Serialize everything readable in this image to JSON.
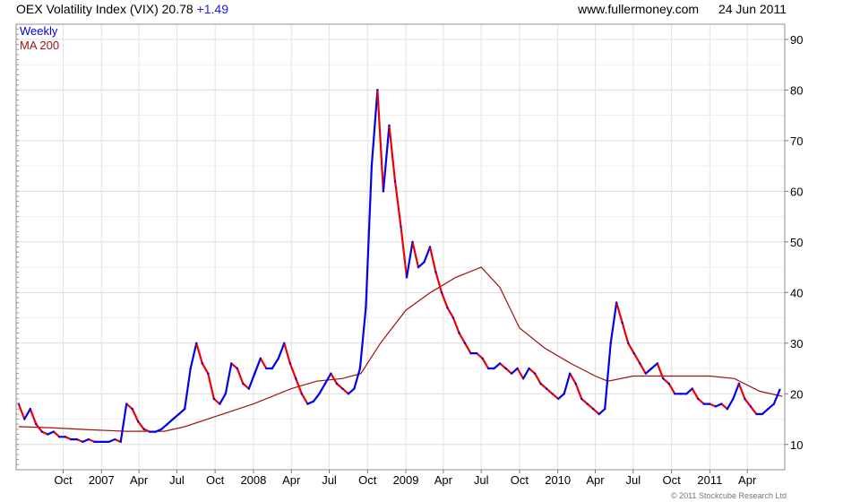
{
  "header": {
    "title": "OEX Volatility Index (VIX)",
    "last": "20.78",
    "change": "+1.49",
    "site": "www.fullermoney.com",
    "date": "24 Jun 2011"
  },
  "footer": {
    "copyright": "© 2011 Stockcube Research Ltd"
  },
  "colors": {
    "up": "#0000ee",
    "down": "#ee0000",
    "ma": "#a01010",
    "grid": "#e3e3e3",
    "frame": "#909090"
  },
  "chart_data": {
    "type": "line",
    "title": "OEX Volatility Index (VIX)",
    "frequency": "Weekly",
    "y_axis_side": "right",
    "ylim": [
      5,
      93
    ],
    "xlim": [
      "2006-06-10",
      "2011-06-30"
    ],
    "grid": true,
    "legend": [
      "Weekly",
      "MA 200"
    ],
    "legend_position": "top-left",
    "y_ticks": [
      10,
      20,
      30,
      40,
      50,
      60,
      70,
      80,
      90
    ],
    "x_ticks": [
      {
        "label": "Oct",
        "date": "2006-10-01"
      },
      {
        "label": "2007",
        "date": "2007-01-01"
      },
      {
        "label": "Apr",
        "date": "2007-04-01"
      },
      {
        "label": "Jul",
        "date": "2007-07-01"
      },
      {
        "label": "Oct",
        "date": "2007-10-01"
      },
      {
        "label": "2008",
        "date": "2008-01-01"
      },
      {
        "label": "Apr",
        "date": "2008-04-01"
      },
      {
        "label": "Jul",
        "date": "2008-07-01"
      },
      {
        "label": "Oct",
        "date": "2008-10-01"
      },
      {
        "label": "2009",
        "date": "2009-01-01"
      },
      {
        "label": "Apr",
        "date": "2009-04-01"
      },
      {
        "label": "Jul",
        "date": "2009-07-01"
      },
      {
        "label": "Oct",
        "date": "2009-10-01"
      },
      {
        "label": "2010",
        "date": "2010-01-01"
      },
      {
        "label": "Apr",
        "date": "2010-04-01"
      },
      {
        "label": "Jul",
        "date": "2010-07-01"
      },
      {
        "label": "Oct",
        "date": "2010-10-01"
      },
      {
        "label": "2011",
        "date": "2011-01-01"
      },
      {
        "label": "Apr",
        "date": "2011-04-01"
      }
    ],
    "series": [
      {
        "name": "Weekly",
        "points": [
          [
            "2006-06-16",
            18
          ],
          [
            "2006-06-30",
            15
          ],
          [
            "2006-07-14",
            17
          ],
          [
            "2006-07-28",
            14
          ],
          [
            "2006-08-11",
            12.5
          ],
          [
            "2006-08-25",
            12
          ],
          [
            "2006-09-08",
            12.5
          ],
          [
            "2006-09-22",
            11.5
          ],
          [
            "2006-10-06",
            11.5
          ],
          [
            "2006-10-20",
            11
          ],
          [
            "2006-11-03",
            11
          ],
          [
            "2006-11-17",
            10.5
          ],
          [
            "2006-12-01",
            11
          ],
          [
            "2006-12-15",
            10.5
          ],
          [
            "2007-01-05",
            10.5
          ],
          [
            "2007-01-19",
            10.5
          ],
          [
            "2007-02-02",
            11
          ],
          [
            "2007-02-16",
            10.5
          ],
          [
            "2007-03-02",
            18
          ],
          [
            "2007-03-16",
            17
          ],
          [
            "2007-03-30",
            14.5
          ],
          [
            "2007-04-13",
            13
          ],
          [
            "2007-04-27",
            12.5
          ],
          [
            "2007-05-11",
            12.5
          ],
          [
            "2007-05-25",
            13
          ],
          [
            "2007-06-08",
            14
          ],
          [
            "2007-06-22",
            15
          ],
          [
            "2007-07-06",
            16
          ],
          [
            "2007-07-20",
            17
          ],
          [
            "2007-08-03",
            25
          ],
          [
            "2007-08-17",
            30
          ],
          [
            "2007-08-31",
            26
          ],
          [
            "2007-09-14",
            24
          ],
          [
            "2007-09-28",
            19
          ],
          [
            "2007-10-12",
            18
          ],
          [
            "2007-10-26",
            20
          ],
          [
            "2007-11-09",
            26
          ],
          [
            "2007-11-23",
            25
          ],
          [
            "2007-12-07",
            22
          ],
          [
            "2007-12-21",
            21
          ],
          [
            "2008-01-04",
            24
          ],
          [
            "2008-01-18",
            27
          ],
          [
            "2008-02-01",
            25
          ],
          [
            "2008-02-15",
            25
          ],
          [
            "2008-03-01",
            27
          ],
          [
            "2008-03-15",
            30
          ],
          [
            "2008-03-29",
            26
          ],
          [
            "2008-04-12",
            23
          ],
          [
            "2008-04-26",
            20
          ],
          [
            "2008-05-10",
            18
          ],
          [
            "2008-05-24",
            18.5
          ],
          [
            "2008-06-07",
            20
          ],
          [
            "2008-06-21",
            22
          ],
          [
            "2008-07-05",
            24
          ],
          [
            "2008-07-19",
            22
          ],
          [
            "2008-08-02",
            21
          ],
          [
            "2008-08-16",
            20
          ],
          [
            "2008-08-30",
            21
          ],
          [
            "2008-09-13",
            25
          ],
          [
            "2008-09-27",
            37
          ],
          [
            "2008-10-11",
            65
          ],
          [
            "2008-10-25",
            80
          ],
          [
            "2008-11-08",
            60
          ],
          [
            "2008-11-22",
            73
          ],
          [
            "2008-12-06",
            62
          ],
          [
            "2008-12-20",
            53
          ],
          [
            "2009-01-03",
            43
          ],
          [
            "2009-01-17",
            50
          ],
          [
            "2009-01-31",
            45
          ],
          [
            "2009-02-14",
            46
          ],
          [
            "2009-02-28",
            49
          ],
          [
            "2009-03-14",
            44
          ],
          [
            "2009-03-28",
            40
          ],
          [
            "2009-04-11",
            37
          ],
          [
            "2009-04-25",
            35
          ],
          [
            "2009-05-09",
            32
          ],
          [
            "2009-05-23",
            30
          ],
          [
            "2009-06-06",
            28
          ],
          [
            "2009-06-20",
            28
          ],
          [
            "2009-07-04",
            27
          ],
          [
            "2009-07-18",
            25
          ],
          [
            "2009-08-01",
            25
          ],
          [
            "2009-08-15",
            26
          ],
          [
            "2009-08-29",
            25
          ],
          [
            "2009-09-12",
            24
          ],
          [
            "2009-09-26",
            25
          ],
          [
            "2009-10-10",
            23
          ],
          [
            "2009-10-24",
            25
          ],
          [
            "2009-11-07",
            24
          ],
          [
            "2009-11-21",
            22
          ],
          [
            "2009-12-05",
            21
          ],
          [
            "2009-12-19",
            20
          ],
          [
            "2010-01-02",
            19
          ],
          [
            "2010-01-16",
            20
          ],
          [
            "2010-01-30",
            24
          ],
          [
            "2010-02-13",
            22
          ],
          [
            "2010-02-27",
            19
          ],
          [
            "2010-03-13",
            18
          ],
          [
            "2010-03-27",
            17
          ],
          [
            "2010-04-10",
            16
          ],
          [
            "2010-04-24",
            17
          ],
          [
            "2010-05-08",
            30
          ],
          [
            "2010-05-22",
            38
          ],
          [
            "2010-06-05",
            34
          ],
          [
            "2010-06-19",
            30
          ],
          [
            "2010-07-03",
            28
          ],
          [
            "2010-07-17",
            26
          ],
          [
            "2010-07-31",
            24
          ],
          [
            "2010-08-14",
            25
          ],
          [
            "2010-08-28",
            26
          ],
          [
            "2010-09-11",
            23
          ],
          [
            "2010-09-25",
            22
          ],
          [
            "2010-10-09",
            20
          ],
          [
            "2010-10-23",
            20
          ],
          [
            "2010-11-06",
            20
          ],
          [
            "2010-11-20",
            21
          ],
          [
            "2010-12-04",
            19
          ],
          [
            "2010-12-18",
            18
          ],
          [
            "2011-01-01",
            18
          ],
          [
            "2011-01-15",
            17.5
          ],
          [
            "2011-01-29",
            18
          ],
          [
            "2011-02-12",
            17
          ],
          [
            "2011-02-26",
            19
          ],
          [
            "2011-03-12",
            22
          ],
          [
            "2011-03-26",
            19
          ],
          [
            "2011-04-09",
            17.5
          ],
          [
            "2011-04-23",
            16
          ],
          [
            "2011-05-07",
            16
          ],
          [
            "2011-05-21",
            17
          ],
          [
            "2011-06-04",
            18
          ],
          [
            "2011-06-18",
            20.78
          ]
        ]
      },
      {
        "name": "MA 200",
        "points": [
          [
            "2006-06-16",
            13.5
          ],
          [
            "2006-09-01",
            13.3
          ],
          [
            "2006-12-01",
            12.9
          ],
          [
            "2007-03-01",
            12.6
          ],
          [
            "2007-06-01",
            12.6
          ],
          [
            "2007-07-20",
            13.5
          ],
          [
            "2007-10-01",
            15.5
          ],
          [
            "2008-01-01",
            18
          ],
          [
            "2008-04-01",
            21
          ],
          [
            "2008-06-01",
            22.5
          ],
          [
            "2008-08-01",
            23
          ],
          [
            "2008-09-15",
            24
          ],
          [
            "2008-11-01",
            30
          ],
          [
            "2009-01-01",
            36.5
          ],
          [
            "2009-03-01",
            40
          ],
          [
            "2009-05-01",
            43
          ],
          [
            "2009-07-01",
            45
          ],
          [
            "2009-08-15",
            41
          ],
          [
            "2009-10-01",
            33
          ],
          [
            "2009-12-01",
            29
          ],
          [
            "2010-02-01",
            26
          ],
          [
            "2010-04-01",
            23.5
          ],
          [
            "2010-05-01",
            22.5
          ],
          [
            "2010-07-01",
            23.5
          ],
          [
            "2010-10-01",
            23.5
          ],
          [
            "2011-01-01",
            23.5
          ],
          [
            "2011-03-01",
            23
          ],
          [
            "2011-05-01",
            20.5
          ],
          [
            "2011-06-24",
            19.5
          ]
        ]
      }
    ]
  }
}
